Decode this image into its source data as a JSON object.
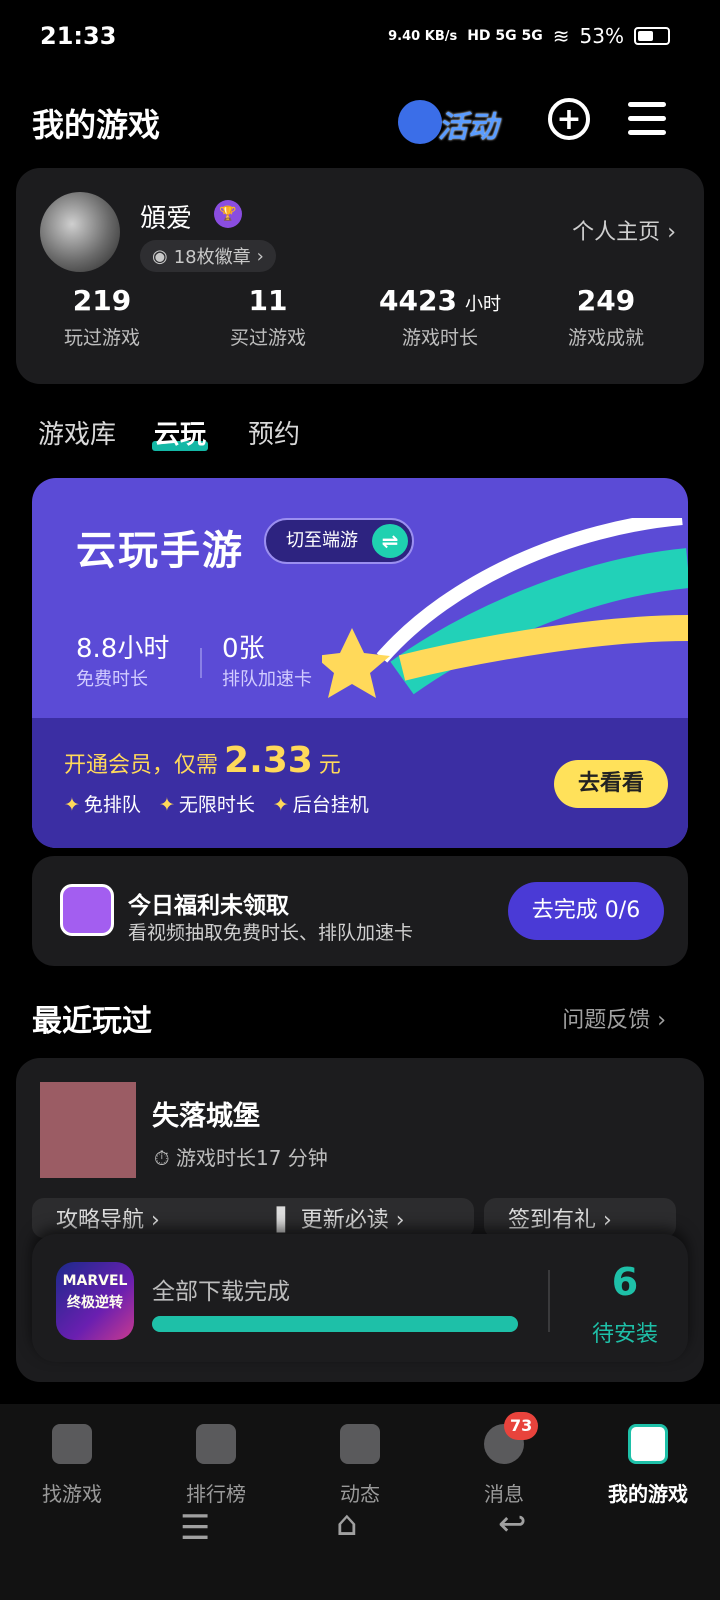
{
  "status_bar": {
    "time": "21:33",
    "net_speed": "9.40 KB/s",
    "signals": "HD 5G 5G",
    "battery": "53%"
  },
  "header": {
    "title": "我的游戏",
    "activity_label": "活动"
  },
  "profile": {
    "username": "頒爱",
    "badges": "18枚徽章",
    "homepage_link": "个人主页",
    "stats": [
      {
        "value": "219",
        "unit": "",
        "label": "玩过游戏"
      },
      {
        "value": "11",
        "unit": "",
        "label": "买过游戏"
      },
      {
        "value": "4423",
        "unit": "小时",
        "label": "游戏时长"
      },
      {
        "value": "249",
        "unit": "",
        "label": "游戏成就"
      }
    ]
  },
  "tabs": [
    {
      "label": "游戏库"
    },
    {
      "label": "云玩"
    },
    {
      "label": "预约"
    }
  ],
  "cloud_banner": {
    "title": "云玩手游",
    "switch_label": "切至端游",
    "free_time_value": "8.8小时",
    "free_time_label": "免费时长",
    "queue_card_value": "0张",
    "queue_card_label": "排队加速卡",
    "vip_prefix": "开通会员，仅需",
    "vip_price": "2.33",
    "vip_suffix": "元",
    "perks": [
      "免排队",
      "无限时长",
      "后台挂机"
    ],
    "cta": "去看看"
  },
  "welfare": {
    "title": "今日福利未领取",
    "subtitle": "看视频抽取免费时长、排队加速卡",
    "cta": "去完成 0/6"
  },
  "recent": {
    "title": "最近玩过",
    "feedback": "问题反馈",
    "game_name": "失落城堡",
    "play_time": "游戏时长17 分钟",
    "chips": [
      "攻略导航 ›",
      "▌ 更新必读 ›",
      "签到有礼 ›"
    ]
  },
  "download": {
    "app_icon_text": "MARVEL 终极逆转",
    "status": "全部下载完成",
    "progress": 1.0,
    "count": "6",
    "count_label": "待安装"
  },
  "bottom_nav": [
    {
      "label": "找游戏"
    },
    {
      "label": "排行榜"
    },
    {
      "label": "动态"
    },
    {
      "label": "消息"
    },
    {
      "label": "我的游戏"
    }
  ],
  "message_badge": "73",
  "colors": {
    "accent": "#1ec0a8",
    "banner": "#5b4bd6",
    "cta_yellow": "#ffe15a"
  }
}
